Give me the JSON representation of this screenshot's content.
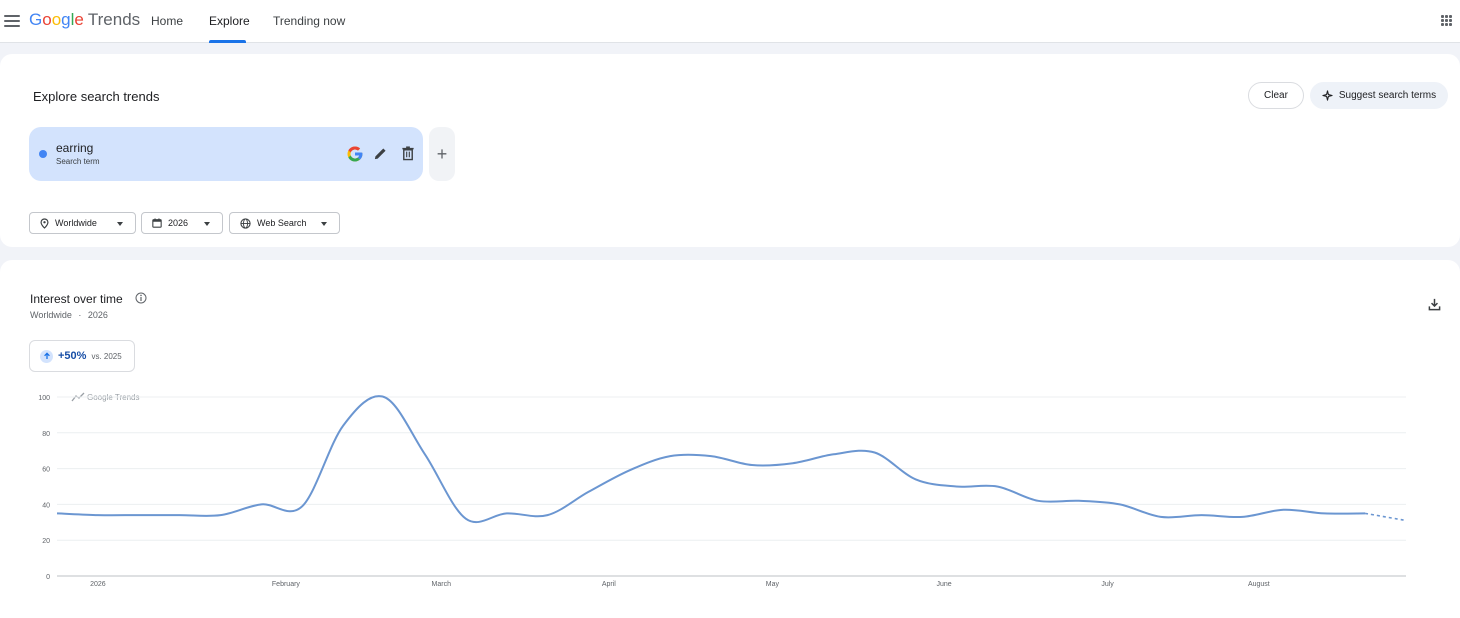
{
  "app": {
    "logo_letters": [
      {
        "ch": "G",
        "color": "#4285f4"
      },
      {
        "ch": "o",
        "color": "#ea4335"
      },
      {
        "ch": "o",
        "color": "#fbbc05"
      },
      {
        "ch": "g",
        "color": "#4285f4"
      },
      {
        "ch": "l",
        "color": "#34a853"
      },
      {
        "ch": "e",
        "color": "#ea4335"
      }
    ],
    "logo_suffix": "Trends"
  },
  "nav": {
    "items": [
      "Home",
      "Explore",
      "Trending now"
    ],
    "active": "Explore"
  },
  "explore": {
    "title": "Explore search trends",
    "clear_label": "Clear",
    "suggest_label": "Suggest search terms",
    "term": {
      "name": "earring",
      "type": "Search term",
      "color": "#4285f4"
    },
    "filters": {
      "location": "Worldwide",
      "time": "2026",
      "property": "Web Search"
    }
  },
  "interest": {
    "title": "Interest over time",
    "subtitle_location": "Worldwide",
    "subtitle_sep": "·",
    "subtitle_time": "2026",
    "change_value": "+50%",
    "change_label": "vs. 2025",
    "watermark": "Google Trends"
  },
  "chart_data": {
    "type": "line",
    "title": "",
    "xlabel": "",
    "ylabel": "",
    "ylim": [
      0,
      100
    ],
    "yticks": [
      0,
      20,
      40,
      60,
      80,
      100
    ],
    "grid": true,
    "x_tick_labels": [
      "2026",
      "February",
      "March",
      "April",
      "May",
      "June",
      "July",
      "August"
    ],
    "x_tick_weeks": [
      1,
      5.6,
      9.4,
      13.5,
      17.5,
      21.7,
      25.7,
      29.4
    ],
    "series": [
      {
        "color": "#6b96d1",
        "points": [
          [
            0,
            35
          ],
          [
            1,
            34
          ],
          [
            2,
            34
          ],
          [
            3,
            34
          ],
          [
            4,
            34
          ],
          [
            5,
            40
          ],
          [
            6,
            39
          ],
          [
            7,
            84
          ],
          [
            8,
            100
          ],
          [
            9,
            68
          ],
          [
            10,
            32
          ],
          [
            11,
            35
          ],
          [
            12,
            34
          ],
          [
            13,
            47
          ],
          [
            14,
            59
          ],
          [
            15,
            67
          ],
          [
            16,
            67
          ],
          [
            17,
            62
          ],
          [
            18,
            63
          ],
          [
            19,
            68
          ],
          [
            20,
            69
          ],
          [
            21,
            54
          ],
          [
            22,
            50
          ],
          [
            23,
            50
          ],
          [
            24,
            42
          ],
          [
            25,
            42
          ],
          [
            26,
            40
          ],
          [
            27,
            33
          ],
          [
            28,
            34
          ],
          [
            29,
            33
          ],
          [
            30,
            37
          ],
          [
            31,
            35
          ],
          [
            32,
            35
          ]
        ],
        "partial_points": [
          [
            32,
            35
          ],
          [
            33,
            31
          ]
        ]
      }
    ]
  }
}
